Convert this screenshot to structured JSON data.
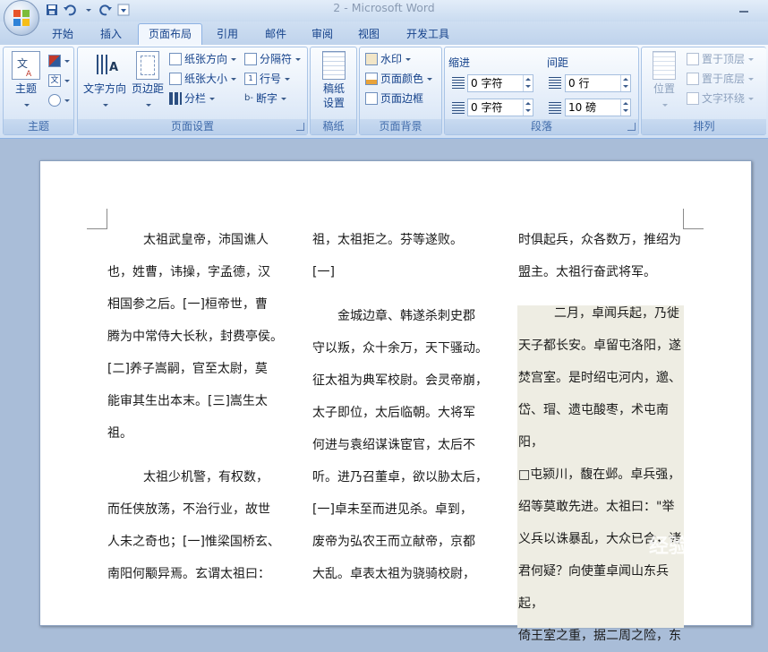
{
  "window": {
    "title": "2 - Microsoft Word"
  },
  "quick_access": {
    "items": [
      "save-icon",
      "undo-icon",
      "redo-icon",
      "customize-icon"
    ]
  },
  "tabs": [
    {
      "label": "开始",
      "active": false
    },
    {
      "label": "插入",
      "active": false
    },
    {
      "label": "页面布局",
      "active": true
    },
    {
      "label": "引用",
      "active": false
    },
    {
      "label": "邮件",
      "active": false
    },
    {
      "label": "审阅",
      "active": false
    },
    {
      "label": "视图",
      "active": false
    },
    {
      "label": "开发工具",
      "active": false
    }
  ],
  "ribbon": {
    "theme": {
      "button": "主题",
      "group": "主题"
    },
    "page_setup": {
      "text_direction": "文字方向",
      "margins": "页边距",
      "orientation": "纸张方向",
      "size": "纸张大小",
      "columns": "分栏",
      "breaks": "分隔符",
      "line_numbers": "行号",
      "hyphenation": "断字",
      "group": "页面设置"
    },
    "manuscript": {
      "button_line1": "稿纸",
      "button_line2": "设置",
      "group": "稿纸"
    },
    "page_background": {
      "watermark": "水印",
      "page_color": "页面颜色",
      "page_borders": "页面边框",
      "group": "页面背景"
    },
    "paragraph": {
      "indent_label": "缩进",
      "indent_left": "0 字符",
      "indent_right": "0 字符",
      "spacing_label": "间距",
      "spacing_before": "0 行",
      "spacing_after": "10 磅",
      "group": "段落"
    },
    "arrange": {
      "position": "位置",
      "bring_front": "置于顶层",
      "send_back": "置于底层",
      "text_wrap": "文字环绕",
      "group": "排列"
    }
  },
  "document": {
    "col1": [
      "太祖武皇帝，沛国谯人",
      "也，姓曹，讳操，字孟德，汉",
      "相国参之后。[一]桓帝世，曹",
      "腾为中常侍大长秋，封费亭侯。",
      "[二]养子嵩嗣，官至太尉，莫",
      "能审其生出本末。[三]嵩生太",
      "祖。",
      "",
      "太祖少机警，有权数，",
      "而任侠放荡，不治行业，故世",
      "人未之奇也；[一]惟梁国桥玄、",
      "南阳何颙异焉。玄谓太祖曰："
    ],
    "col2": [
      "祖，太祖拒之。芬等遂败。",
      "[一]",
      "",
      "金城边章、韩遂杀刺史郡",
      "守以叛，众十余万，天下骚动。",
      "征太祖为典军校尉。会灵帝崩，",
      "太子即位，太后临朝。大将军",
      "何进与袁绍谋诛宦官，太后不",
      "听。进乃召董卓，欲以胁太后，",
      "[一]卓未至而进见杀。卓到，",
      "废帝为弘农王而立献帝，京都",
      "大乱。卓表太祖为骁骑校尉，"
    ],
    "col3": [
      "时俱起兵，众各数万，推绍为",
      "盟主。太祖行奋武将军。",
      "",
      "二月，卓闻兵起，乃徙",
      "天子都长安。卓留屯洛阳，遂",
      "焚宫室。是时绍屯河内，邈、",
      "岱、瑁、遗屯酸枣，术屯南阳，",
      "□屯颍川，馥在邺。卓兵强，",
      "绍等莫敢先进。太祖曰：\"举",
      "义兵以诛暴乱，大众已合，诸",
      "君何疑？向使董卓闻山东兵起，",
      "倚王室之重，据二周之险，东"
    ],
    "watermark_text": "经验"
  }
}
